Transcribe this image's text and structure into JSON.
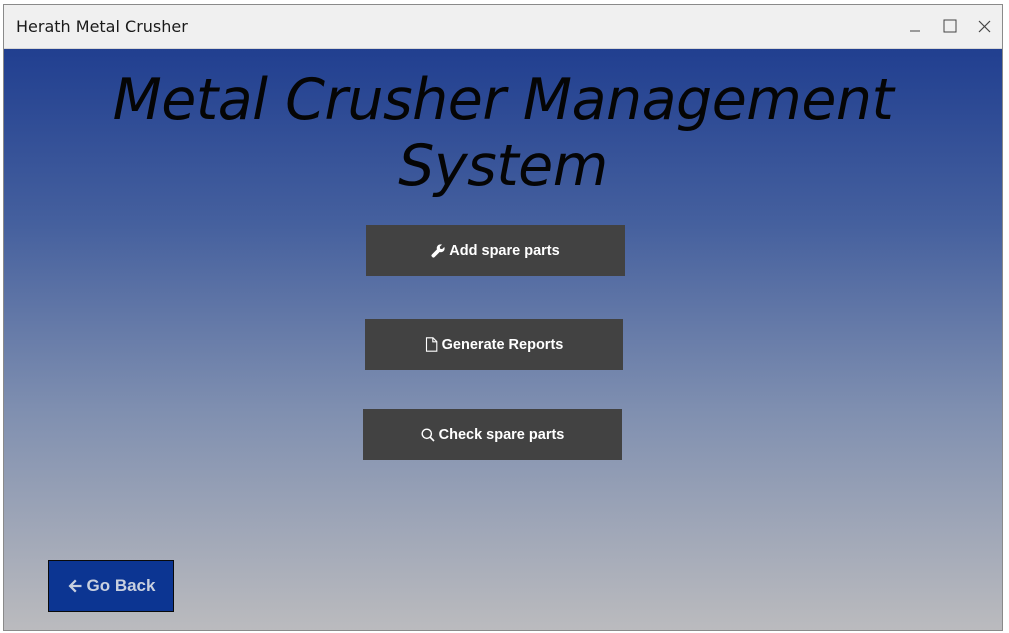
{
  "window": {
    "title": "Herath Metal Crusher",
    "controls": [
      "minimize-icon",
      "maximize-icon",
      "close-icon"
    ]
  },
  "main": {
    "heading": "Metal Crusher Management System",
    "buttons": [
      {
        "label": "Add spare parts",
        "icon": "wrench-icon"
      },
      {
        "label": "Generate Reports",
        "icon": "document-icon"
      },
      {
        "label": "Check spare parts",
        "icon": "search-icon"
      }
    ],
    "back_button": {
      "label": "Go Back",
      "icon": "arrow-left-icon"
    }
  },
  "colors": {
    "gradient_top": "#213f90",
    "gradient_bottom": "#bbbbbe",
    "button_bg": "#424242",
    "back_button_bg": "#0c3592"
  }
}
